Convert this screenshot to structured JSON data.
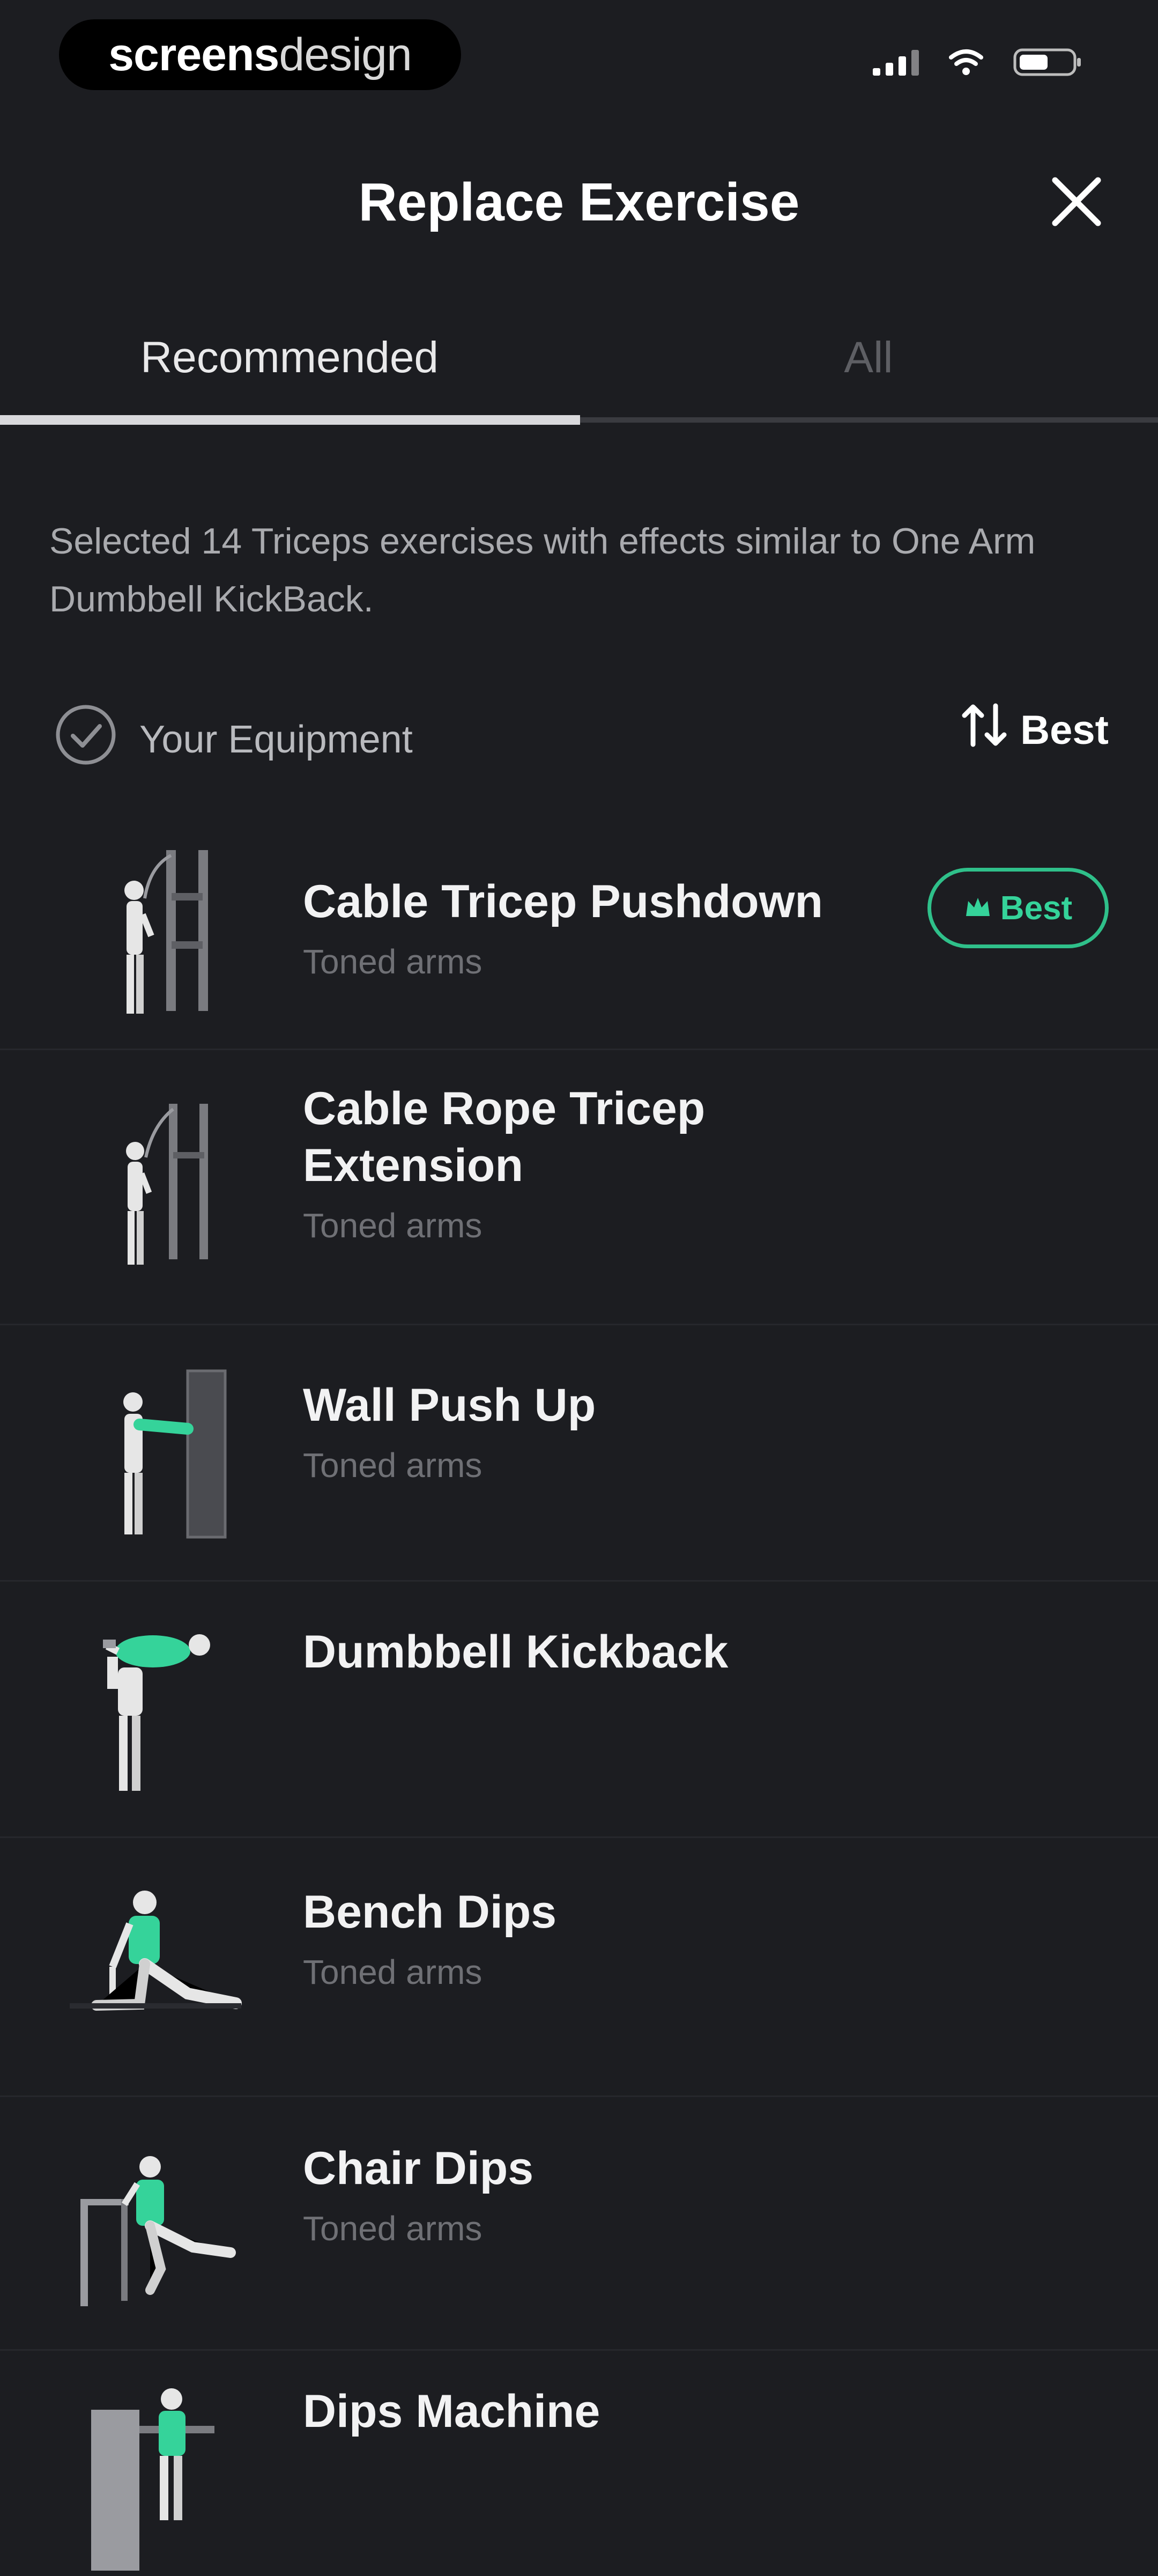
{
  "status_bar": {
    "brand_bold": "screens",
    "brand_light": "design"
  },
  "header": {
    "title": "Replace Exercise"
  },
  "tabs": [
    {
      "label": "Recommended",
      "active": true
    },
    {
      "label": "All",
      "active": false
    }
  ],
  "description": "Selected 14 Triceps exercises with effects similar to One Arm Dumbbell KickBack.",
  "filter": {
    "equipment_label": "Your Equipment",
    "sort_label": "Best"
  },
  "badge_label": "Best",
  "exercises": [
    {
      "name": "Cable Tricep Pushdown",
      "subtitle": "Toned arms",
      "badge": true
    },
    {
      "name": "Cable Rope Tricep Extension",
      "subtitle": "Toned arms",
      "badge": false
    },
    {
      "name": "Wall Push Up",
      "subtitle": "Toned arms",
      "badge": false
    },
    {
      "name": "Dumbbell Kickback",
      "subtitle": "",
      "badge": false
    },
    {
      "name": "Bench Dips",
      "subtitle": "Toned arms",
      "badge": false
    },
    {
      "name": "Chair Dips",
      "subtitle": "Toned arms",
      "badge": false
    },
    {
      "name": "Dips Machine",
      "subtitle": "",
      "badge": false
    }
  ],
  "colors": {
    "background": "#1c1d21",
    "accent": "#35d39a",
    "muted_text": "#6f7075"
  },
  "icons": [
    "signal-icon",
    "wifi-icon",
    "battery-icon",
    "close-icon",
    "check-circle-icon",
    "sort-icon",
    "crown-icon"
  ]
}
